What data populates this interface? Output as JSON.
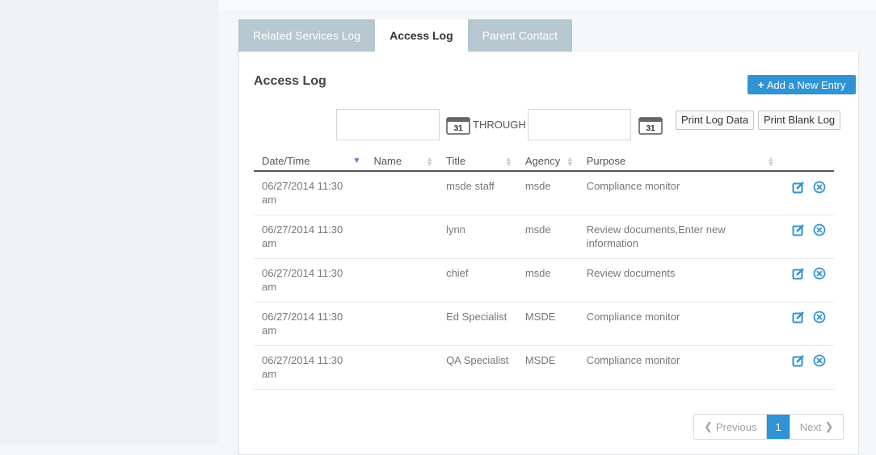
{
  "tabs": [
    {
      "label": "Related Services Log",
      "active": false
    },
    {
      "label": "Access Log",
      "active": true
    },
    {
      "label": "Parent Contact",
      "active": false
    }
  ],
  "panel": {
    "title": "Access Log",
    "add_label": "Add a New Entry",
    "date_from": {
      "value": "",
      "placeholder": ""
    },
    "date_to": {
      "value": "",
      "placeholder": ""
    },
    "calendar_day": "31",
    "through_label": "THROUGH",
    "print_log_label": "Print Log Data",
    "print_blank_label": "Print Blank Log"
  },
  "table": {
    "columns": [
      "Date/Time",
      "Name",
      "Title",
      "Agency",
      "Purpose",
      ""
    ],
    "rows": [
      {
        "datetime": "06/27/2014 11:30 am",
        "name": "",
        "title": "msde staff",
        "agency": "msde",
        "purpose": "Compliance monitor"
      },
      {
        "datetime": "06/27/2014 11:30 am",
        "name": "",
        "title": "lynn",
        "agency": "msde",
        "purpose": "Review documents,Enter new information"
      },
      {
        "datetime": "06/27/2014 11:30 am",
        "name": "",
        "title": "chief",
        "agency": "msde",
        "purpose": "Review documents"
      },
      {
        "datetime": "06/27/2014 11:30 am",
        "name": "",
        "title": "Ed Specialist",
        "agency": "MSDE",
        "purpose": "Compliance monitor"
      },
      {
        "datetime": "06/27/2014 11:30 am",
        "name": "",
        "title": "QA Specialist",
        "agency": "MSDE",
        "purpose": "Compliance monitor"
      }
    ]
  },
  "pager": {
    "previous_label": "Previous",
    "current_page": "1",
    "next_label": "Next"
  },
  "colors": {
    "accent": "#2f93d5",
    "tab_inactive": "#b7c7cf",
    "sort_active": "#6c6ccf"
  },
  "icons": [
    "plus-icon",
    "calendar-icon",
    "sort-icon",
    "edit-icon",
    "delete-icon",
    "chevron-left-icon",
    "chevron-right-icon"
  ]
}
